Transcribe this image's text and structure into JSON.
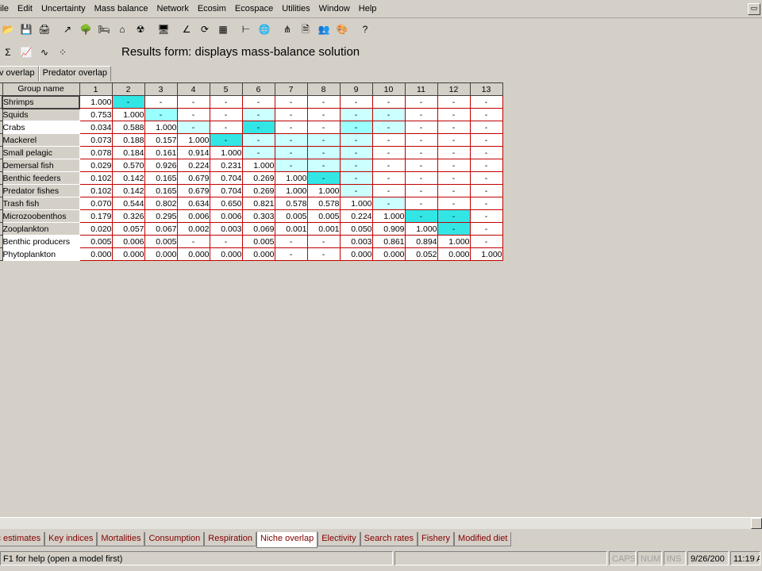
{
  "menu": [
    "ile",
    "Edit",
    "Uncertainty",
    "Mass balance",
    "Network",
    "Ecosim",
    "Ecospace",
    "Utilities",
    "Window",
    "Help"
  ],
  "mdi_restore_icon": "window-restore-icon",
  "toolbar_icons": [
    "folder-open-icon",
    "save-icon",
    "print-icon",
    "sep",
    "edit-arrow-icon",
    "tree-icon",
    "bed-icon",
    "house-icon",
    "radiation-icon",
    "sep",
    "monitor-icon",
    "sep",
    "angle-icon",
    "rotate-icon",
    "grid-icon",
    "sep",
    "axis-icon",
    "globe-icon",
    "sep",
    "network-icon",
    "document-icon",
    "people-icon",
    "palette-icon",
    "sep",
    "help-icon"
  ],
  "toolbar2_icons": [
    "sigma-icon",
    "line-chart-icon",
    "curve-chart-icon",
    "dots-icon"
  ],
  "form_title": "Results form: displays mass-balance solution",
  "subtabs": [
    "v overlap",
    "Predator overlap"
  ],
  "grid": {
    "corner_label": "Group name",
    "columns": [
      "1",
      "2",
      "3",
      "4",
      "5",
      "6",
      "7",
      "8",
      "9",
      "10",
      "11",
      "12",
      "13"
    ],
    "rows": [
      {
        "name": "Shrimps",
        "values": [
          "1.000",
          "-",
          "-",
          "-",
          "-",
          "-",
          "-",
          "-",
          "-",
          "-",
          "-",
          "-",
          "-"
        ]
      },
      {
        "name": "Squids",
        "values": [
          "0.753",
          "1.000",
          "-",
          "-",
          "-",
          "-",
          "-",
          "-",
          "-",
          "-",
          "-",
          "-",
          "-"
        ]
      },
      {
        "name": "Crabs",
        "values": [
          "0.034",
          "0.588",
          "1.000",
          "-",
          "-",
          "-",
          "-",
          "-",
          "-",
          "-",
          "-",
          "-",
          "-"
        ]
      },
      {
        "name": "Mackerel",
        "values": [
          "0.073",
          "0.188",
          "0.157",
          "1.000",
          "-",
          "-",
          "-",
          "-",
          "-",
          "-",
          "-",
          "-",
          "-"
        ]
      },
      {
        "name": "Small pelagic",
        "values": [
          "0.078",
          "0.184",
          "0.161",
          "0.914",
          "1.000",
          "-",
          "-",
          "-",
          "-",
          "-",
          "-",
          "-",
          "-"
        ]
      },
      {
        "name": "Demersal fish",
        "values": [
          "0.029",
          "0.570",
          "0.926",
          "0.224",
          "0.231",
          "1.000",
          "-",
          "-",
          "-",
          "-",
          "-",
          "-",
          "-"
        ]
      },
      {
        "name": "Benthic feeders",
        "values": [
          "0.102",
          "0.142",
          "0.165",
          "0.679",
          "0.704",
          "0.269",
          "1.000",
          "-",
          "-",
          "-",
          "-",
          "-",
          "-"
        ]
      },
      {
        "name": "Predator fishes",
        "values": [
          "0.102",
          "0.142",
          "0.165",
          "0.679",
          "0.704",
          "0.269",
          "1.000",
          "1.000",
          "-",
          "-",
          "-",
          "-",
          "-"
        ]
      },
      {
        "name": "Trash fish",
        "values": [
          "0.070",
          "0.544",
          "0.802",
          "0.634",
          "0.650",
          "0.821",
          "0.578",
          "0.578",
          "1.000",
          "-",
          "-",
          "-",
          "-"
        ]
      },
      {
        "name": "Microzoobenthos",
        "values": [
          "0.179",
          "0.326",
          "0.295",
          "0.006",
          "0.006",
          "0.303",
          "0.005",
          "0.005",
          "0.224",
          "1.000",
          "-",
          "-",
          "-"
        ]
      },
      {
        "name": "Zooplankton",
        "values": [
          "0.020",
          "0.057",
          "0.067",
          "0.002",
          "0.003",
          "0.069",
          "0.001",
          "0.001",
          "0.050",
          "0.909",
          "1.000",
          "-",
          "-"
        ]
      },
      {
        "name": "Benthic producers",
        "values": [
          "0.005",
          "0.006",
          "0.005",
          "-",
          "-",
          "0.005",
          "-",
          "-",
          "0.003",
          "0.861",
          "0.894",
          "1.000",
          "-"
        ]
      },
      {
        "name": "Phytoplankton",
        "values": [
          "0.000",
          "0.000",
          "0.000",
          "0.000",
          "0.000",
          "0.000",
          "-",
          "-",
          "0.000",
          "0.000",
          "0.052",
          "0.000",
          "1.000"
        ]
      }
    ],
    "cell_colors": [
      [
        "",
        "s",
        "",
        "",
        "",
        "",
        "",
        "",
        "",
        "",
        "",
        "",
        ""
      ],
      [
        "",
        "",
        "m",
        "",
        "",
        "l",
        "",
        "",
        "l",
        "l",
        "",
        "",
        ""
      ],
      [
        "",
        "",
        "",
        "l",
        "",
        "s",
        "",
        "",
        "m",
        "l",
        "",
        "",
        ""
      ],
      [
        "",
        "",
        "",
        "",
        "s",
        "l",
        "l",
        "l",
        "l",
        "",
        "",
        "",
        ""
      ],
      [
        "",
        "",
        "",
        "",
        "",
        "l",
        "l",
        "l",
        "l",
        "",
        "",
        "",
        ""
      ],
      [
        "",
        "",
        "",
        "",
        "",
        "",
        "l",
        "l",
        "l",
        "",
        "",
        "",
        ""
      ],
      [
        "",
        "",
        "",
        "",
        "",
        "",
        "",
        "s",
        "l",
        "",
        "",
        "",
        ""
      ],
      [
        "",
        "",
        "",
        "",
        "",
        "",
        "",
        "",
        "l",
        "",
        "",
        "",
        ""
      ],
      [
        "",
        "",
        "",
        "",
        "",
        "",
        "",
        "",
        "",
        "l",
        "",
        "",
        ""
      ],
      [
        "",
        "",
        "",
        "",
        "",
        "",
        "",
        "",
        "",
        "",
        "s",
        "s",
        ""
      ],
      [
        "",
        "",
        "",
        "",
        "",
        "",
        "",
        "",
        "",
        "",
        "",
        "s",
        ""
      ],
      [
        "",
        "",
        "",
        "",
        "",
        "",
        "",
        "",
        "",
        "",
        "",
        "",
        ""
      ],
      [
        "",
        "",
        "",
        "",
        "",
        "",
        "",
        "",
        "",
        "",
        "",
        "",
        ""
      ]
    ],
    "name_fill_white_rows": [
      2,
      11,
      12
    ],
    "selected_row": 0,
    "colors": {
      "strong": "#33e6e6",
      "medium": "#99ffff",
      "light": "#ccffff",
      "grid_line": "#c00000"
    }
  },
  "bottom_tabs": [
    "ic estimates",
    "Key indices",
    "Mortalities",
    "Consumption",
    "Respiration",
    "Niche overlap",
    "Electivity",
    "Search rates",
    "Fishery",
    "Modified diet"
  ],
  "active_bottom_tab": 5,
  "status": {
    "message": "F1 for help (open a model first)",
    "caps": "CAPS",
    "num": "NUM",
    "ins": "INS",
    "date": "9/26/200",
    "time": "11:19 A"
  }
}
